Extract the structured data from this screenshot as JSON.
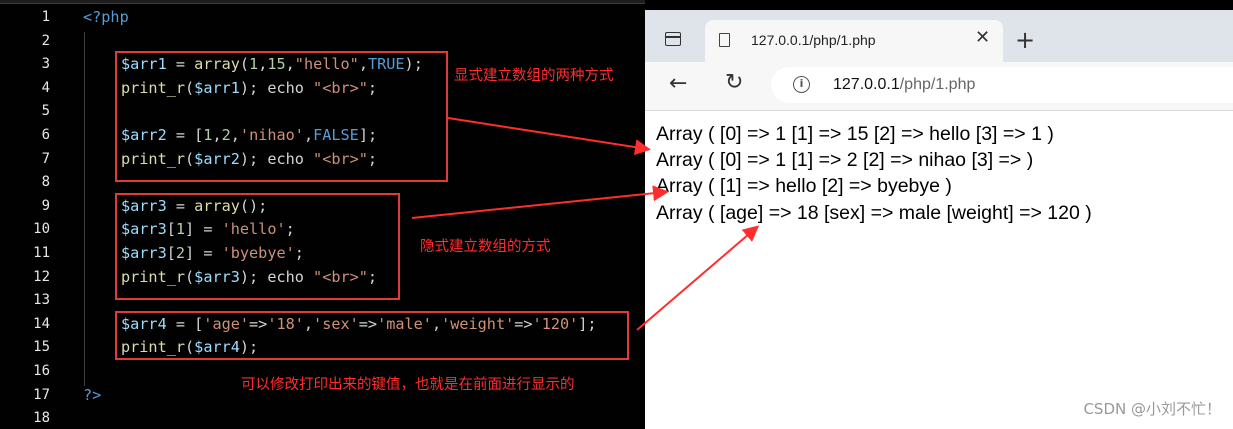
{
  "editor": {
    "line_numbers": [
      "1",
      "2",
      "3",
      "4",
      "5",
      "6",
      "7",
      "8",
      "9",
      "10",
      "11",
      "12",
      "13",
      "14",
      "15",
      "16",
      "17",
      "18"
    ],
    "lines": [
      [
        {
          "t": "<?php",
          "c": "tag"
        }
      ],
      [],
      [
        {
          "t": "$arr1",
          "c": "var"
        },
        {
          "t": " = ",
          "c": "def"
        },
        {
          "t": "array",
          "c": "fn"
        },
        {
          "t": "(",
          "c": "def"
        },
        {
          "t": "1",
          "c": "num"
        },
        {
          "t": ",",
          "c": "def"
        },
        {
          "t": "15",
          "c": "num"
        },
        {
          "t": ",",
          "c": "def"
        },
        {
          "t": "\"hello\"",
          "c": "str"
        },
        {
          "t": ",",
          "c": "def"
        },
        {
          "t": "TRUE",
          "c": "kw"
        },
        {
          "t": ");",
          "c": "def"
        }
      ],
      [
        {
          "t": "print_r",
          "c": "fn"
        },
        {
          "t": "(",
          "c": "def"
        },
        {
          "t": "$arr1",
          "c": "var"
        },
        {
          "t": "); echo ",
          "c": "def"
        },
        {
          "t": "\"<br>\"",
          "c": "str"
        },
        {
          "t": ";",
          "c": "def"
        }
      ],
      [],
      [
        {
          "t": "$arr2",
          "c": "var"
        },
        {
          "t": " = [",
          "c": "def"
        },
        {
          "t": "1",
          "c": "num"
        },
        {
          "t": ",",
          "c": "def"
        },
        {
          "t": "2",
          "c": "num"
        },
        {
          "t": ",",
          "c": "def"
        },
        {
          "t": "'nihao'",
          "c": "str"
        },
        {
          "t": ",",
          "c": "def"
        },
        {
          "t": "FALSE",
          "c": "kw"
        },
        {
          "t": "];",
          "c": "def"
        }
      ],
      [
        {
          "t": "print_r",
          "c": "fn"
        },
        {
          "t": "(",
          "c": "def"
        },
        {
          "t": "$arr2",
          "c": "var"
        },
        {
          "t": "); echo ",
          "c": "def"
        },
        {
          "t": "\"<br>\"",
          "c": "str"
        },
        {
          "t": ";",
          "c": "def"
        }
      ],
      [],
      [
        {
          "t": "$arr3",
          "c": "var"
        },
        {
          "t": " = ",
          "c": "def"
        },
        {
          "t": "array",
          "c": "fn"
        },
        {
          "t": "();",
          "c": "def"
        }
      ],
      [
        {
          "t": "$arr3",
          "c": "var"
        },
        {
          "t": "[",
          "c": "def"
        },
        {
          "t": "1",
          "c": "num"
        },
        {
          "t": "] = ",
          "c": "def"
        },
        {
          "t": "'hello'",
          "c": "str"
        },
        {
          "t": ";",
          "c": "def"
        }
      ],
      [
        {
          "t": "$arr3",
          "c": "var"
        },
        {
          "t": "[",
          "c": "def"
        },
        {
          "t": "2",
          "c": "num"
        },
        {
          "t": "] = ",
          "c": "def"
        },
        {
          "t": "'byebye'",
          "c": "str"
        },
        {
          "t": ";",
          "c": "def"
        }
      ],
      [
        {
          "t": "print_r",
          "c": "fn"
        },
        {
          "t": "(",
          "c": "def"
        },
        {
          "t": "$arr3",
          "c": "var"
        },
        {
          "t": "); echo ",
          "c": "def"
        },
        {
          "t": "\"<br>\"",
          "c": "str"
        },
        {
          "t": ";",
          "c": "def"
        }
      ],
      [],
      [
        {
          "t": "$arr4",
          "c": "var"
        },
        {
          "t": " = [",
          "c": "def"
        },
        {
          "t": "'age'",
          "c": "str"
        },
        {
          "t": "=>",
          "c": "def"
        },
        {
          "t": "'18'",
          "c": "str"
        },
        {
          "t": ",",
          "c": "def"
        },
        {
          "t": "'sex'",
          "c": "str"
        },
        {
          "t": "=>",
          "c": "def"
        },
        {
          "t": "'male'",
          "c": "str"
        },
        {
          "t": ",",
          "c": "def"
        },
        {
          "t": "'weight'",
          "c": "str"
        },
        {
          "t": "=>",
          "c": "def"
        },
        {
          "t": "'120'",
          "c": "str"
        },
        {
          "t": "];",
          "c": "def"
        }
      ],
      [
        {
          "t": "print_r",
          "c": "fn"
        },
        {
          "t": "(",
          "c": "def"
        },
        {
          "t": "$arr4",
          "c": "var"
        },
        {
          "t": ");",
          "c": "def"
        }
      ],
      [],
      [
        {
          "t": "?>",
          "c": "tag"
        }
      ],
      []
    ],
    "syntax_colors": {
      "tag": "#569cd6",
      "var": "#9cdcfe",
      "fn": "#dcdcaa",
      "num": "#b5cea8",
      "str": "#ce9178",
      "kw": "#569cd6",
      "def": "#d4d4d4"
    }
  },
  "annotations": {
    "explicit": "显式建立数组的两种方式",
    "implicit": "隐式建立数组的方式",
    "modify_keys": "可以修改打印出来的键值，也就是在前面进行显示的",
    "color": "#ff2d2d"
  },
  "browser": {
    "tab_title": "127.0.0.1/php/1.php",
    "tab_close": "✕",
    "new_tab": "+",
    "back": "←",
    "reload": "↻",
    "info": "i",
    "url_host": "127.0.0.1",
    "url_path": "/php/1.php",
    "output_lines": [
      "Array ( [0] => 1 [1] => 15 [2] => hello [3] => 1 )",
      "Array ( [0] => 1 [1] => 2 [2] => nihao [3] => )",
      "Array ( [1] => hello [2] => byebye )",
      "Array ( [age] => 18 [sex] => male [weight] => 120 )"
    ]
  },
  "watermark": "CSDN @小刘不忙！"
}
